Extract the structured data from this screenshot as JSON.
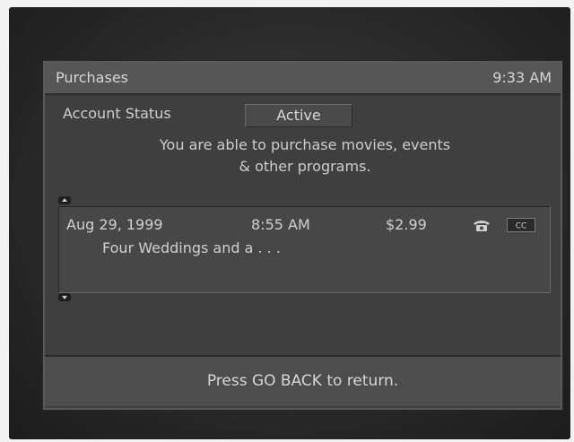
{
  "screen": {
    "title": "Purchases",
    "clock": "9:33 AM"
  },
  "account": {
    "label": "Account Status",
    "status": "Active",
    "message_line1": "You are able to purchase movies, events",
    "message_line2": "& other programs."
  },
  "purchases": [
    {
      "date": "Aug 29, 1999",
      "time": "8:55 AM",
      "price": "$2.99",
      "title": "Four Weddings and a . . .",
      "icons": [
        "phone-icon",
        "closed-caption-icon"
      ]
    }
  ],
  "footer": {
    "hint": "Press GO BACK to return."
  }
}
